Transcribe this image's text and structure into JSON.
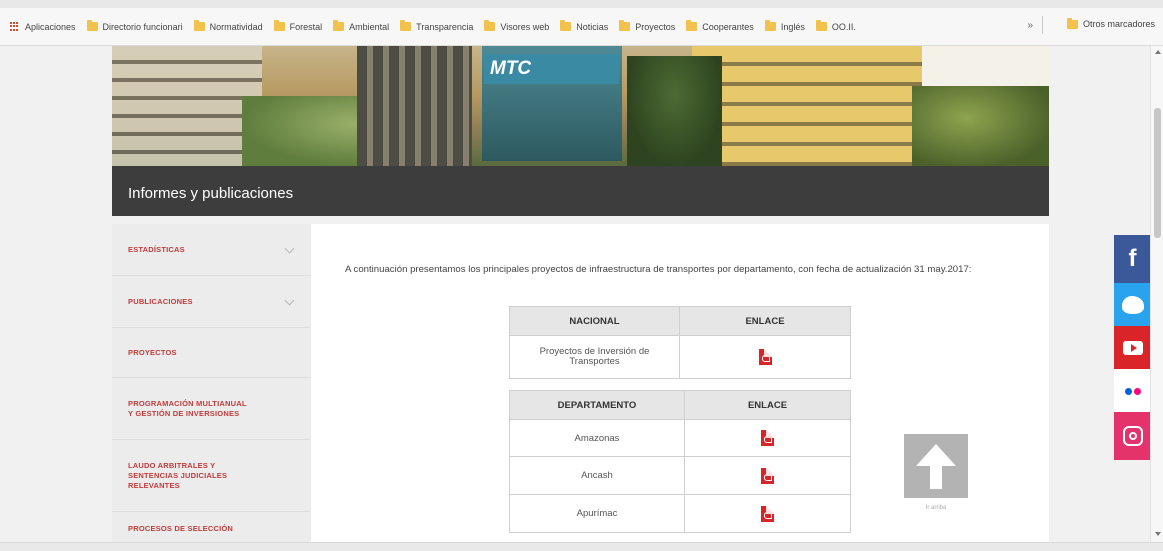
{
  "bookmarks": {
    "apps": "Aplicaciones",
    "items": [
      "Directorio funcionari",
      "Normatividad",
      "Forestal",
      "Ambiental",
      "Transparencia",
      "Visores web",
      "Noticias",
      "Proyectos",
      "Cooperantes",
      "Inglés",
      "OO.II."
    ],
    "more": "»",
    "other": "Otros marcadores"
  },
  "header": {
    "logo": "MTC",
    "page_title": "Informes y publicaciones"
  },
  "sidebar": {
    "items": [
      {
        "label": "ESTADÍSTICAS"
      },
      {
        "label": "PUBLICACIONES"
      },
      {
        "label": "PROYECTOS"
      },
      {
        "label": "PROGRAMACIÓN MULTIANUAL Y GESTIÓN DE INVERSIONES"
      },
      {
        "label": "LAUDO ARBITRALES Y SENTENCIAS JUDICIALES RELEVANTES"
      },
      {
        "label": "PROCESOS DE SELECCIÓN"
      }
    ]
  },
  "main": {
    "intro": "A continuación presentamos los principales proyectos de infraestructura de transportes por departamento, con fecha de actualización 31 may.2017:",
    "nacional_table": {
      "headers": [
        "NACIONAL",
        "ENLACE"
      ],
      "rows": [
        {
          "name": "Proyectos de Inversión de Transportes"
        }
      ]
    },
    "departamento_table": {
      "headers": [
        "DEPARTAMENTO",
        "ENLACE"
      ],
      "rows": [
        {
          "name": "Amazonas"
        },
        {
          "name": "Ancash"
        },
        {
          "name": "Apurímac"
        }
      ]
    },
    "back_to_top": "Ir arriba"
  },
  "social": {
    "facebook_glyph": "f"
  },
  "colors": {
    "menu_text": "#c33b3b",
    "title_bar": "#3d3d3d",
    "pdf_icon": "#d6262b",
    "facebook": "#3b5998",
    "twitter": "#2aa3ef",
    "youtube": "#d9252a",
    "instagram": "#e4326a"
  }
}
